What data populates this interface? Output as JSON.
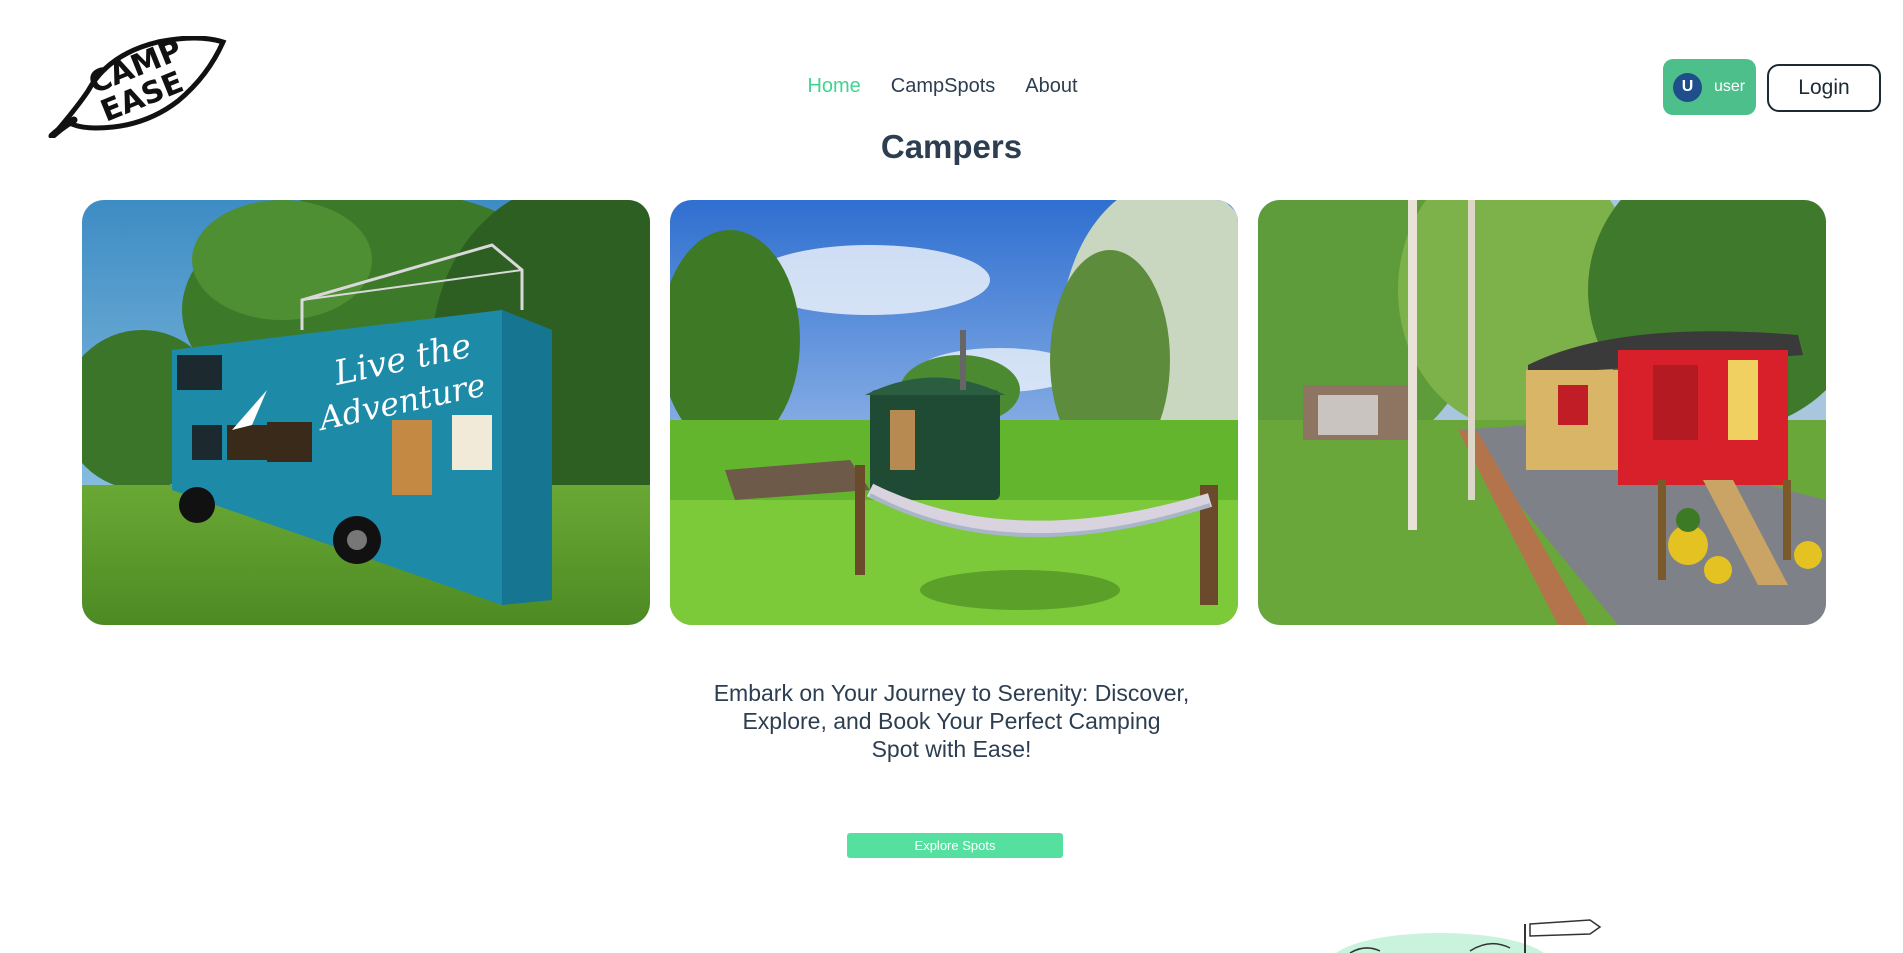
{
  "header": {
    "logo_text": "CAMP EASE",
    "nav": [
      {
        "label": "Home",
        "active": true
      },
      {
        "label": "CampSpots",
        "active": false
      },
      {
        "label": "About",
        "active": false
      }
    ],
    "user": {
      "initial": "U",
      "name": "user"
    },
    "login_label": "Login"
  },
  "main": {
    "title": "Campers",
    "images": [
      {
        "name": "camper-bus-image",
        "painted_text": "Live the Adventure"
      },
      {
        "name": "shepherd-hut-hammock-image"
      },
      {
        "name": "red-wagon-caravan-image"
      }
    ],
    "tagline_lines": [
      "Embark on Your Journey to Serenity: Discover,",
      "Explore, and Book Your Perfect Camping",
      "Spot with Ease!"
    ],
    "cta_label": "Explore Spots"
  },
  "colors": {
    "accent": "#42d392",
    "user_badge": "#4dbf8a",
    "avatar": "#1f4e8c",
    "cta": "#55e0a0",
    "text": "#2c3e50"
  }
}
